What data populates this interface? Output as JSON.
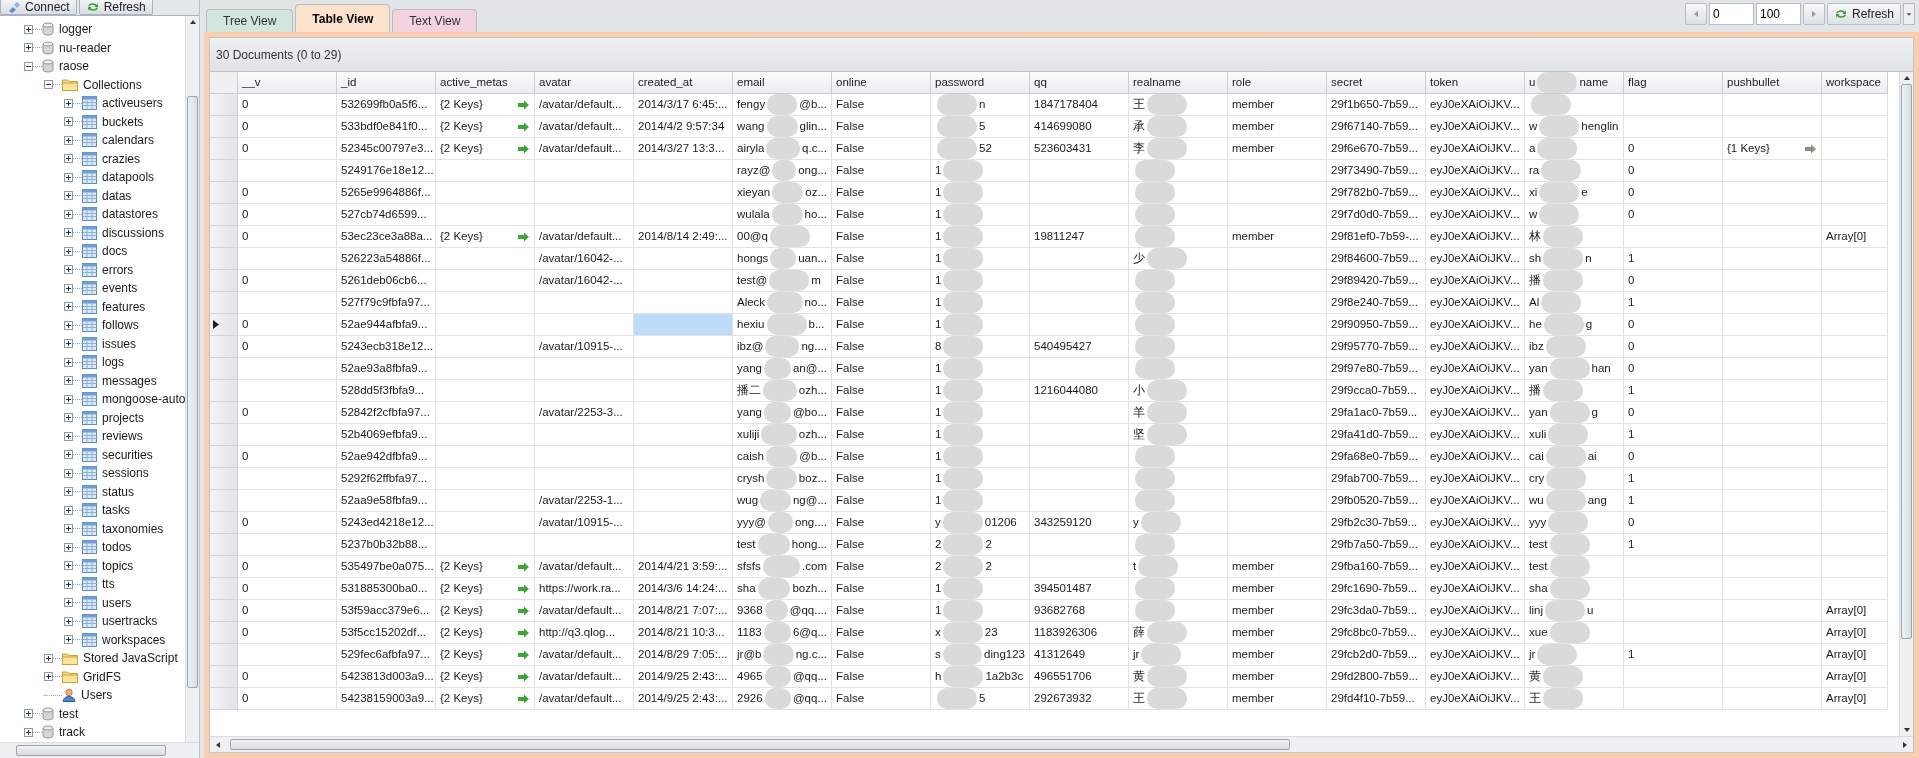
{
  "toolbar": {
    "buttons": [
      {
        "label": "Connect",
        "kind": "connect"
      },
      {
        "label": "Refresh",
        "kind": "refresh"
      }
    ]
  },
  "tree": [
    {
      "label": "logger",
      "kind": "database",
      "expanded": false
    },
    {
      "label": "nu-reader",
      "kind": "database",
      "expanded": false
    },
    {
      "label": "raose",
      "kind": "database",
      "expanded": true,
      "children": [
        {
          "label": "Collections",
          "kind": "folder",
          "expanded": true,
          "children": [
            {
              "label": "activeusers",
              "kind": "collection",
              "expanded": false
            },
            {
              "label": "buckets",
              "kind": "collection",
              "expanded": false
            },
            {
              "label": "calendars",
              "kind": "collection",
              "expanded": false
            },
            {
              "label": "crazies",
              "kind": "collection",
              "expanded": false
            },
            {
              "label": "datapools",
              "kind": "collection",
              "expanded": false
            },
            {
              "label": "datas",
              "kind": "collection",
              "expanded": false
            },
            {
              "label": "datastores",
              "kind": "collection",
              "expanded": false
            },
            {
              "label": "discussions",
              "kind": "collection",
              "expanded": false
            },
            {
              "label": "docs",
              "kind": "collection",
              "expanded": false
            },
            {
              "label": "errors",
              "kind": "collection",
              "expanded": false
            },
            {
              "label": "events",
              "kind": "collection",
              "expanded": false
            },
            {
              "label": "features",
              "kind": "collection",
              "expanded": false
            },
            {
              "label": "follows",
              "kind": "collection",
              "expanded": false
            },
            {
              "label": "issues",
              "kind": "collection",
              "expanded": false
            },
            {
              "label": "logs",
              "kind": "collection",
              "expanded": false
            },
            {
              "label": "messages",
              "kind": "collection",
              "expanded": false
            },
            {
              "label": "mongoose-auto",
              "kind": "collection",
              "expanded": false
            },
            {
              "label": "projects",
              "kind": "collection",
              "expanded": false
            },
            {
              "label": "reviews",
              "kind": "collection",
              "expanded": false
            },
            {
              "label": "securities",
              "kind": "collection",
              "expanded": false
            },
            {
              "label": "sessions",
              "kind": "collection",
              "expanded": false
            },
            {
              "label": "status",
              "kind": "collection",
              "expanded": false
            },
            {
              "label": "tasks",
              "kind": "collection",
              "expanded": false
            },
            {
              "label": "taxonomies",
              "kind": "collection",
              "expanded": false
            },
            {
              "label": "todos",
              "kind": "collection",
              "expanded": false
            },
            {
              "label": "topics",
              "kind": "collection",
              "expanded": false
            },
            {
              "label": "tts",
              "kind": "collection",
              "expanded": false
            },
            {
              "label": "users",
              "kind": "collection",
              "expanded": false
            },
            {
              "label": "usertracks",
              "kind": "collection",
              "expanded": false
            },
            {
              "label": "workspaces",
              "kind": "collection",
              "expanded": false
            }
          ]
        },
        {
          "label": "Stored JavaScript",
          "kind": "folder",
          "expanded": false
        },
        {
          "label": "GridFS",
          "kind": "folder",
          "expanded": false
        },
        {
          "label": "Users",
          "kind": "users"
        }
      ]
    },
    {
      "label": "test",
      "kind": "database",
      "expanded": false
    },
    {
      "label": "track",
      "kind": "database",
      "expanded": false
    }
  ],
  "tabs": [
    {
      "label": "Tree View",
      "selected": false,
      "color": "#d3e6dc"
    },
    {
      "label": "Table View",
      "selected": true,
      "color": "#fde3cc"
    },
    {
      "label": "Text View",
      "selected": false,
      "color": "#f3d3e0"
    }
  ],
  "pager": {
    "skip": "0",
    "limit": "100",
    "refresh": "Refresh"
  },
  "caption": "30 Documents (0 to 29)",
  "table": {
    "columns": [
      {
        "label": "__v",
        "kind": "text"
      },
      {
        "label": "_id",
        "kind": "text"
      },
      {
        "label": "active_metas",
        "kind": "object"
      },
      {
        "label": "avatar",
        "kind": "text"
      },
      {
        "label": "created_at",
        "kind": "text"
      },
      {
        "label": "email",
        "kind": "redacted"
      },
      {
        "label": "online",
        "kind": "text"
      },
      {
        "label": "password",
        "kind": "redacted"
      },
      {
        "label": "qq",
        "kind": "text"
      },
      {
        "label": "realname",
        "kind": "redacted"
      },
      {
        "label": "role",
        "kind": "text"
      },
      {
        "label": "secret",
        "kind": "text"
      },
      {
        "label": "token",
        "kind": "text"
      },
      {
        "label": {
          "before": "u",
          "after": "name"
        },
        "kind": "redacted"
      },
      {
        "label": "flag",
        "kind": "text"
      },
      {
        "label": "pushbullet",
        "kind": "object"
      },
      {
        "label": "workspace",
        "kind": "text"
      }
    ],
    "rows": [
      {
        "selected": false,
        "cells": [
          "0",
          "532699fb0a5f6...",
          {
            "text": "{2 Keys}",
            "color": "#3fa535"
          },
          "/avatar/default...",
          "2014/3/17 6:45:...",
          {
            "before": "fengy",
            "after": "@b..."
          },
          "False",
          {
            "after": "n"
          },
          "1847178404",
          {
            "before": "王"
          },
          "member",
          "29f1b650-7b59...",
          "eyJ0eXAiOiJKV...",
          null,
          null,
          null,
          null
        ]
      },
      {
        "selected": false,
        "cells": [
          "0",
          "533bdf0e841f0...",
          {
            "text": "{2 Keys}",
            "color": "#3fa535"
          },
          "/avatar/default...",
          "2014/4/2 9:57:34",
          {
            "before": "wang",
            "after": "glin..."
          },
          "False",
          {
            "after": "5"
          },
          "414699080",
          {
            "before": "承"
          },
          "member",
          "29f67140-7b59...",
          "eyJ0eXAiOiJKV...",
          {
            "before": "w",
            "after": "henglin"
          },
          null,
          null,
          null
        ]
      },
      {
        "selected": false,
        "cells": [
          "0",
          "52345c00797e3...",
          {
            "text": "{2 Keys}",
            "color": "#3fa535"
          },
          "/avatar/default...",
          "2014/3/27 13:3...",
          {
            "before": "airyla",
            "after": "q.c..."
          },
          "False",
          {
            "after": "52"
          },
          "523603431",
          {
            "before": "李"
          },
          "member",
          "29f6e670-7b59...",
          "eyJ0eXAiOiJKV...",
          {
            "before": "a"
          },
          "0",
          {
            "text": "{1 Keys}",
            "color": "#8c8c80"
          },
          null
        ]
      },
      {
        "selected": false,
        "cells": [
          null,
          "5249176e18e12...",
          null,
          null,
          null,
          {
            "before": "rayz@",
            "after": "ong..."
          },
          "False",
          {
            "before": "1"
          },
          null,
          null,
          null,
          "29f73490-7b59...",
          "eyJ0eXAiOiJKV...",
          {
            "before": "ra"
          },
          "0",
          null,
          null
        ]
      },
      {
        "selected": false,
        "cells": [
          "0",
          "5265e9964886f...",
          null,
          null,
          null,
          {
            "before": "xieyan",
            "after": "oz..."
          },
          "False",
          {
            "before": "1"
          },
          null,
          null,
          null,
          "29f782b0-7b59...",
          "eyJ0eXAiOiJKV...",
          {
            "before": "xi",
            "after": "e"
          },
          "0",
          null,
          null
        ]
      },
      {
        "selected": false,
        "cells": [
          "0",
          "527cb74d6599...",
          null,
          null,
          null,
          {
            "before": "wulala",
            "after": "ho..."
          },
          "False",
          {
            "before": "1"
          },
          null,
          null,
          null,
          "29f7d0d0-7b59...",
          "eyJ0eXAiOiJKV...",
          {
            "before": "w"
          },
          "0",
          null,
          null
        ]
      },
      {
        "selected": false,
        "cells": [
          "0",
          "53ec23ce3a88a...",
          {
            "text": "{2 Keys}",
            "color": "#3fa535"
          },
          "/avatar/default...",
          "2014/8/14 2:49:...",
          {
            "before": "00@q"
          },
          "False",
          {
            "before": "1"
          },
          "19811247",
          null,
          "member",
          "29f81ef0-7b59-...",
          "eyJ0eXAiOiJKV...",
          {
            "before": "林"
          },
          null,
          null,
          "Array[0]"
        ]
      },
      {
        "selected": false,
        "cells": [
          null,
          "526223a54886f...",
          null,
          "/avatar/16042-...",
          null,
          {
            "before": "hongs",
            "after": "uan..."
          },
          "False",
          {
            "before": "1"
          },
          null,
          {
            "before": "少"
          },
          null,
          "29f84600-7b59...",
          "eyJ0eXAiOiJKV...",
          {
            "before": "sh",
            "after": "n"
          },
          "1",
          null,
          null
        ]
      },
      {
        "selected": false,
        "cells": [
          "0",
          "5261deb06cb6...",
          null,
          "/avatar/16042-...",
          null,
          {
            "before": "test@",
            "after": "m"
          },
          "False",
          {
            "before": "1"
          },
          null,
          null,
          null,
          "29f89420-7b59...",
          "eyJ0eXAiOiJKV...",
          {
            "before": "播"
          },
          "0",
          null,
          null
        ]
      },
      {
        "selected": false,
        "cells": [
          null,
          "527f79c9fbfa97...",
          null,
          null,
          null,
          {
            "before": "Aleck",
            "after": "no..."
          },
          "False",
          {
            "before": "1"
          },
          null,
          null,
          null,
          "29f8e240-7b59...",
          "eyJ0eXAiOiJKV...",
          {
            "before": "Al"
          },
          "1",
          null,
          null
        ]
      },
      {
        "selected": true,
        "cells": [
          "0",
          "52ae944afbfa9...",
          null,
          null,
          {
            "selected": true
          },
          {
            "before": "hexiu",
            "after": "b..."
          },
          "False",
          {
            "before": "1"
          },
          null,
          null,
          null,
          "29f90950-7b59...",
          "eyJ0eXAiOiJKV...",
          {
            "before": "he",
            "after": "g"
          },
          "0",
          null,
          null
        ]
      },
      {
        "selected": false,
        "cells": [
          "0",
          "5243ecb318e12...",
          null,
          "/avatar/10915-...",
          null,
          {
            "before": "ibz@",
            "after": "ng...."
          },
          "False",
          {
            "before": "8"
          },
          "540495427",
          null,
          null,
          "29f95770-7b59...",
          "eyJ0eXAiOiJKV...",
          {
            "before": "ibz"
          },
          "0",
          null,
          null
        ]
      },
      {
        "selected": false,
        "cells": [
          null,
          "52ae93a8fbfa9...",
          null,
          null,
          null,
          {
            "before": "yang",
            "after": "an@..."
          },
          "False",
          {
            "before": "1"
          },
          null,
          null,
          null,
          "29f97e80-7b59...",
          "eyJ0eXAiOiJKV...",
          {
            "before": "yan",
            "after": "han"
          },
          "0",
          null,
          null
        ]
      },
      {
        "selected": false,
        "cells": [
          null,
          "528dd5f3fbfa9...",
          null,
          null,
          null,
          {
            "before": "播二",
            "after": "ozh..."
          },
          "False",
          {
            "before": "1"
          },
          "1216044080",
          {
            "before": "小"
          },
          null,
          "29f9cca0-7b59...",
          "eyJ0eXAiOiJKV...",
          {
            "before": "播"
          },
          "1",
          null,
          null
        ]
      },
      {
        "selected": false,
        "cells": [
          "0",
          "52842f2cfbfa97...",
          null,
          "/avatar/2253-3...",
          null,
          {
            "before": "yang",
            "after": "@bo..."
          },
          "False",
          {
            "before": "1"
          },
          null,
          {
            "before": "羊"
          },
          null,
          "29fa1ac0-7b59...",
          "eyJ0eXAiOiJKV...",
          {
            "before": "yan",
            "after": "g"
          },
          "0",
          null,
          null
        ]
      },
      {
        "selected": false,
        "cells": [
          null,
          "52b4069efbfa9...",
          null,
          null,
          null,
          {
            "before": "xuliji",
            "after": "ozh..."
          },
          "False",
          {
            "before": "1"
          },
          null,
          {
            "before": "坚"
          },
          null,
          "29fa41d0-7b59...",
          "eyJ0eXAiOiJKV...",
          {
            "before": "xuli"
          },
          "1",
          null,
          null
        ]
      },
      {
        "selected": false,
        "cells": [
          "0",
          "52ae942dfbfa9...",
          null,
          null,
          null,
          {
            "before": "caish",
            "after": "@b..."
          },
          "False",
          {
            "before": "1"
          },
          null,
          null,
          null,
          "29fa68e0-7b59...",
          "eyJ0eXAiOiJKV...",
          {
            "before": "cai",
            "after": "ai"
          },
          "0",
          null,
          null
        ]
      },
      {
        "selected": false,
        "cells": [
          null,
          "5292f62ffbfa97...",
          null,
          null,
          null,
          {
            "before": "crysh",
            "after": "boz..."
          },
          "False",
          {
            "before": "1"
          },
          null,
          null,
          null,
          "29fab700-7b59...",
          "eyJ0eXAiOiJKV...",
          {
            "before": "cry"
          },
          "1",
          null,
          null
        ]
      },
      {
        "selected": false,
        "cells": [
          null,
          "52aa9e58fbfa9...",
          null,
          "/avatar/2253-1...",
          null,
          {
            "before": "wug",
            "after": "ng@..."
          },
          "False",
          {
            "before": "1"
          },
          null,
          null,
          null,
          "29fb0520-7b59...",
          "eyJ0eXAiOiJKV...",
          {
            "before": "wu",
            "after": "ang"
          },
          "1",
          null,
          null
        ]
      },
      {
        "selected": false,
        "cells": [
          "0",
          "5243ed4218e12...",
          null,
          "/avatar/10915-...",
          null,
          {
            "before": "yyy@",
            "after": "ong...."
          },
          "False",
          {
            "before": "y",
            "after": "01206"
          },
          "343259120",
          {
            "before": "y"
          },
          null,
          "29fb2c30-7b59...",
          "eyJ0eXAiOiJKV...",
          {
            "before": "yyy"
          },
          "0",
          null,
          null
        ]
      },
      {
        "selected": false,
        "cells": [
          null,
          "5237b0b32b88...",
          null,
          null,
          null,
          {
            "before": "test",
            "after": "hong..."
          },
          "False",
          {
            "before": "2",
            "after": "2"
          },
          null,
          null,
          null,
          "29fb7a50-7b59...",
          "eyJ0eXAiOiJKV...",
          {
            "before": "test"
          },
          "1",
          null,
          null
        ]
      },
      {
        "selected": false,
        "cells": [
          "0",
          "535497be0a075...",
          {
            "text": "{2 Keys}",
            "color": "#3fa535"
          },
          "/avatar/default...",
          "2014/4/21 3:59:...",
          {
            "before": "sfsfs",
            "after": ".com"
          },
          "False",
          {
            "before": "2",
            "after": "2"
          },
          null,
          {
            "before": "t"
          },
          "member",
          "29fba160-7b59...",
          "eyJ0eXAiOiJKV...",
          {
            "before": "test"
          },
          null,
          null,
          null
        ]
      },
      {
        "selected": false,
        "cells": [
          "0",
          "531885300ba0...",
          {
            "text": "{2 Keys}",
            "color": "#3fa535"
          },
          "https://work.ra...",
          "2014/3/6 14:24:...",
          {
            "before": "sha",
            "after": "bozh..."
          },
          "False",
          {
            "before": "1"
          },
          "394501487",
          null,
          "member",
          "29fc1690-7b59...",
          "eyJ0eXAiOiJKV...",
          {
            "before": "sha"
          },
          null,
          null,
          null
        ]
      },
      {
        "selected": false,
        "cells": [
          "0",
          "53f59acc379e6...",
          {
            "text": "{2 Keys}",
            "color": "#3fa535"
          },
          "/avatar/default...",
          "2014/8/21 7:07:...",
          {
            "before": "9368",
            "after": "@qq...."
          },
          "False",
          {
            "before": "1"
          },
          "93682768",
          null,
          "member",
          "29fc3da0-7b59...",
          "eyJ0eXAiOiJKV...",
          {
            "before": "linj",
            "after": "u"
          },
          null,
          null,
          "Array[0]"
        ]
      },
      {
        "selected": false,
        "cells": [
          "0",
          "53f5cc15202df...",
          {
            "text": "{2 Keys}",
            "color": "#3fa535"
          },
          "http://q3.qlog...",
          "2014/8/21 10:3...",
          {
            "before": "1183",
            "after": "6@q..."
          },
          "False",
          {
            "before": "x",
            "after": "23"
          },
          "1183926306",
          {
            "before": "薛"
          },
          "member",
          "29fc8bc0-7b59...",
          "eyJ0eXAiOiJKV...",
          {
            "before": "xue"
          },
          null,
          null,
          "Array[0]"
        ]
      },
      {
        "selected": false,
        "cells": [
          null,
          "529fec6afbfa97...",
          {
            "text": "{2 Keys}",
            "color": "#3fa535"
          },
          "/avatar/default...",
          "2014/8/29 7:05:...",
          {
            "before": "jr@b",
            "after": "ng.c..."
          },
          "False",
          {
            "before": "s",
            "after": "ding123"
          },
          "41312649",
          {
            "before": "jr"
          },
          "member",
          "29fcb2d0-7b59...",
          "eyJ0eXAiOiJKV...",
          {
            "before": "jr"
          },
          "1",
          null,
          "Array[0]"
        ]
      },
      {
        "selected": false,
        "cells": [
          "0",
          "5423813d003a9...",
          {
            "text": "{2 Keys}",
            "color": "#3fa535"
          },
          "/avatar/default...",
          "2014/9/25 2:43:...",
          {
            "before": "4965",
            "after": "@qq..."
          },
          "False",
          {
            "before": "h",
            "after": "1a2b3c"
          },
          "496551706",
          {
            "before": "黄"
          },
          "member",
          "29fd2800-7b59...",
          "eyJ0eXAiOiJKV...",
          {
            "before": "黄"
          },
          null,
          null,
          "Array[0]"
        ]
      },
      {
        "selected": false,
        "cells": [
          "0",
          "54238159003a9...",
          {
            "text": "{2 Keys}",
            "color": "#3fa535"
          },
          "/avatar/default...",
          "2014/9/25 2:43:...",
          {
            "before": "2926",
            "after": "@qq..."
          },
          "False",
          {
            "after": "5"
          },
          "292673932",
          {
            "before": "王"
          },
          "member",
          "29fd4f10-7b59...",
          "eyJ0eXAiOiJKV...",
          {
            "before": "王"
          },
          null,
          null,
          "Array[0]"
        ]
      }
    ]
  }
}
